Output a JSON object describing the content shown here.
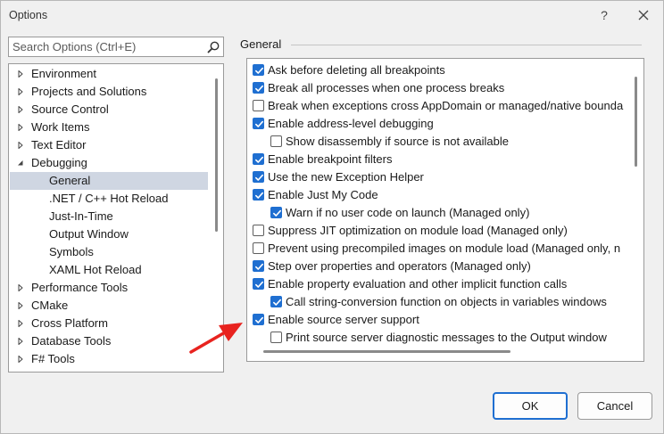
{
  "window": {
    "title": "Options",
    "help_glyph": "?",
    "close_icon": "close-icon"
  },
  "search": {
    "placeholder": "Search Options (Ctrl+E)",
    "icon": "search-icon"
  },
  "tree": {
    "items": [
      {
        "label": "Environment",
        "level": 0,
        "expander": "collapsed"
      },
      {
        "label": "Projects and Solutions",
        "level": 0,
        "expander": "collapsed"
      },
      {
        "label": "Source Control",
        "level": 0,
        "expander": "collapsed"
      },
      {
        "label": "Work Items",
        "level": 0,
        "expander": "collapsed"
      },
      {
        "label": "Text Editor",
        "level": 0,
        "expander": "collapsed"
      },
      {
        "label": "Debugging",
        "level": 0,
        "expander": "expanded"
      },
      {
        "label": "General",
        "level": 1,
        "expander": "none",
        "selected": true
      },
      {
        "label": ".NET / C++ Hot Reload",
        "level": 1,
        "expander": "none"
      },
      {
        "label": "Just-In-Time",
        "level": 1,
        "expander": "none"
      },
      {
        "label": "Output Window",
        "level": 1,
        "expander": "none"
      },
      {
        "label": "Symbols",
        "level": 1,
        "expander": "none"
      },
      {
        "label": "XAML Hot Reload",
        "level": 1,
        "expander": "none"
      },
      {
        "label": "Performance Tools",
        "level": 0,
        "expander": "collapsed"
      },
      {
        "label": "CMake",
        "level": 0,
        "expander": "collapsed"
      },
      {
        "label": "Cross Platform",
        "level": 0,
        "expander": "collapsed"
      },
      {
        "label": "Database Tools",
        "level": 0,
        "expander": "collapsed"
      },
      {
        "label": "F# Tools",
        "level": 0,
        "expander": "collapsed"
      }
    ]
  },
  "section": {
    "title": "General"
  },
  "options": [
    {
      "label": "Ask before deleting all breakpoints",
      "checked": true,
      "indent": 0
    },
    {
      "label": "Break all processes when one process breaks",
      "checked": true,
      "indent": 0
    },
    {
      "label": "Break when exceptions cross AppDomain or managed/native bounda",
      "checked": false,
      "indent": 0
    },
    {
      "label": "Enable address-level debugging",
      "checked": true,
      "indent": 0
    },
    {
      "label": "Show disassembly if source is not available",
      "checked": false,
      "indent": 1
    },
    {
      "label": "Enable breakpoint filters",
      "checked": true,
      "indent": 0
    },
    {
      "label": "Use the new Exception Helper",
      "checked": true,
      "indent": 0
    },
    {
      "label": "Enable Just My Code",
      "checked": true,
      "indent": 0
    },
    {
      "label": "Warn if no user code on launch (Managed only)",
      "checked": true,
      "indent": 1
    },
    {
      "label": "Suppress JIT optimization on module load (Managed only)",
      "checked": false,
      "indent": 0
    },
    {
      "label": "Prevent using precompiled images on module load (Managed only, n",
      "checked": false,
      "indent": 0
    },
    {
      "label": "Step over properties and operators (Managed only)",
      "checked": true,
      "indent": 0
    },
    {
      "label": "Enable property evaluation and other implicit function calls",
      "checked": true,
      "indent": 0
    },
    {
      "label": "Call string-conversion function on objects in variables windows",
      "checked": true,
      "indent": 1
    },
    {
      "label": "Enable source server support",
      "checked": true,
      "indent": 0
    },
    {
      "label": "Print source server diagnostic messages to the Output window",
      "checked": false,
      "indent": 1
    }
  ],
  "buttons": {
    "ok": "OK",
    "cancel": "Cancel"
  },
  "colors": {
    "accent": "#1f6fd1",
    "selection": "#cfd6e2",
    "annotation_arrow": "#e8231f"
  }
}
